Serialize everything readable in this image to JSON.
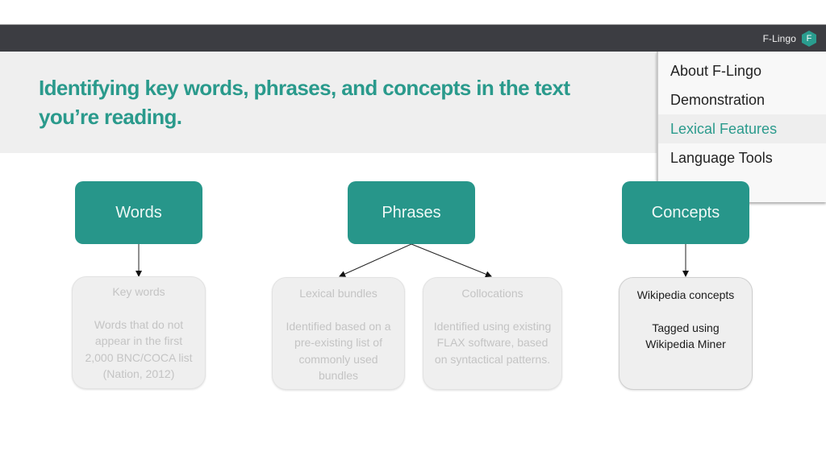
{
  "topbar": {
    "brand_name": "F-Lingo",
    "logo_letter": "F",
    "logo_icon": "hexagon-logo-icon"
  },
  "header": {
    "title_line1": "Identifying key words, phrases, and concepts in the text",
    "title_line2": "you’re reading."
  },
  "nav_menu": {
    "items": [
      {
        "label": "About F-Lingo",
        "active": false
      },
      {
        "label": "Demonstration",
        "active": false
      },
      {
        "label": "Lexical Features",
        "active": true
      },
      {
        "label": "Language Tools",
        "active": false
      }
    ]
  },
  "diagram": {
    "categories": [
      {
        "label": "Words"
      },
      {
        "label": "Phrases"
      },
      {
        "label": "Concepts"
      }
    ],
    "subitems": [
      {
        "title": "Key words",
        "description": "Words that do not appear in the first 2,000 BNC/COCA list (Nation, 2012)",
        "parent": "Words",
        "highlighted": false
      },
      {
        "title": "Lexical bundles",
        "description": "Identified based on a pre-existing list of commonly used bundles",
        "parent": "Phrases",
        "highlighted": false
      },
      {
        "title": "Collocations",
        "description": "Identified using existing FLAX software, based on syntactical patterns.",
        "parent": "Phrases",
        "highlighted": false
      },
      {
        "title": "Wikipedia concepts",
        "description": "Tagged using Wikipedia Miner",
        "parent": "Concepts",
        "highlighted": true
      }
    ]
  },
  "colors": {
    "accent": "#27968a",
    "title_text": "#2a9a8c",
    "topbar": "#3c3d42",
    "header_band": "#efefef",
    "dimmed_text": "#c4c4c4"
  }
}
